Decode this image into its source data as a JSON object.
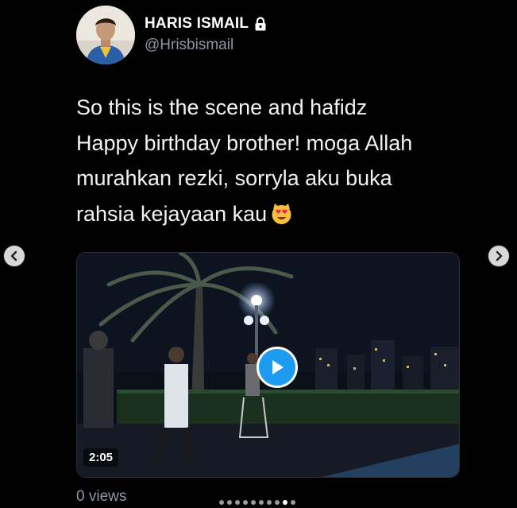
{
  "profile": {
    "display_name": "HARIS ISMAIL",
    "handle": "@Hrisbismail",
    "protected_icon": "lock-icon"
  },
  "tweet": {
    "lines": [
      "So this is the scene and hafidz",
      "Happy birthday brother! moga Allah",
      "murahkan rezki, sorryla aku buka",
      "rahsia kejayaan kau"
    ],
    "emoji": "smiling-cat-heart-eyes"
  },
  "media": {
    "type": "video",
    "duration": "2:05",
    "play_icon": "play-icon",
    "accent": "#1d9bf0"
  },
  "views": "0 views",
  "carousel": {
    "prev_icon": "chevron-left-icon",
    "next_icon": "chevron-right-icon",
    "total_slides": 10,
    "active_slide": 9
  },
  "colors": {
    "background": "#000000",
    "secondary_text": "#8b98a5"
  }
}
